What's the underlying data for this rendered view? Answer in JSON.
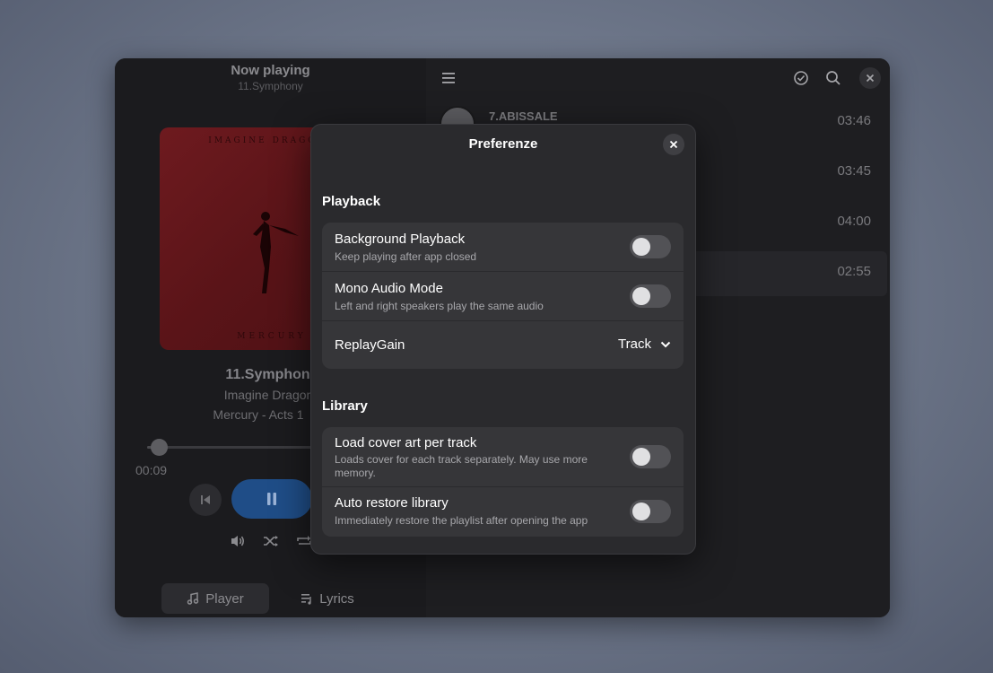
{
  "player": {
    "header_title": "Now playing",
    "header_subtitle": "11.Symphony",
    "cover": {
      "band_name": "IMAGINE DRAGONS",
      "album_text": "MERCURY"
    },
    "song_title": "11.Symphony",
    "song_artist": "Imagine Dragons",
    "song_album": "Mercury - Acts 1",
    "time_elapsed": "00:09",
    "progress_fraction": 0.05
  },
  "tabs": [
    {
      "label": "Player",
      "icon": "music-note-icon"
    },
    {
      "label": "Lyrics",
      "icon": "lyrics-icon"
    }
  ],
  "tracks": [
    {
      "name": "7.ABISSALE",
      "duration": "03:46"
    },
    {
      "name": "",
      "duration": "03:45"
    },
    {
      "name": "",
      "duration": "04:00"
    },
    {
      "name": "",
      "duration": "02:55",
      "active": true
    }
  ],
  "header_icons": [
    "menu-icon",
    "select-icon",
    "search-icon",
    "close-icon"
  ],
  "dialog": {
    "title": "Preferenze",
    "sections": [
      {
        "title": "Playback",
        "rows": [
          {
            "title": "Background Playback",
            "subtitle": "Keep playing after app closed",
            "toggle": false
          },
          {
            "title": "Mono Audio Mode",
            "subtitle": "Left and right speakers play the same audio",
            "toggle": false
          },
          {
            "title": "ReplayGain",
            "value": "Track"
          }
        ]
      },
      {
        "title": "Library",
        "rows": [
          {
            "title": "Load cover art per track",
            "subtitle": "Loads cover for each track separately. May use more memory.",
            "toggle": false
          },
          {
            "title": "Auto restore library",
            "subtitle": "Immediately restore the playlist after opening the app",
            "toggle": false
          }
        ]
      }
    ]
  },
  "colors": {
    "accent": "#1f4d87",
    "dialog_bg": "#2a2a2d",
    "row_bg": "#363639"
  }
}
